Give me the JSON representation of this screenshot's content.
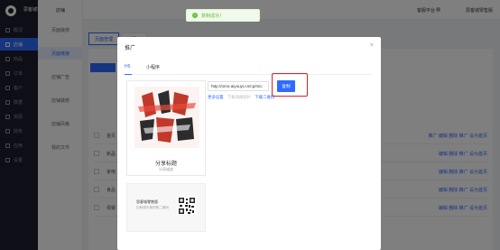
{
  "app": {
    "brand": "思客城零售版"
  },
  "topbar": {
    "help": "客服平台",
    "user": "思客城零售版"
  },
  "sidebar": {
    "items": [
      {
        "label": "概况"
      },
      {
        "label": "店铺"
      },
      {
        "label": "商品"
      },
      {
        "label": "订单"
      },
      {
        "label": "客户"
      },
      {
        "label": "数据"
      },
      {
        "label": "资源"
      },
      {
        "label": "财务"
      },
      {
        "label": "应用"
      },
      {
        "label": "设置"
      }
    ]
  },
  "subside": {
    "title": "店铺",
    "items": [
      {
        "label": "页面装修"
      },
      {
        "label": "页面链接"
      },
      {
        "label": "店铺广告"
      },
      {
        "label": "店铺装修"
      },
      {
        "label": "店铺风格"
      },
      {
        "label": "我的文件"
      }
    ]
  },
  "page": {
    "tabs": [
      {
        "label": "页面管理"
      },
      {
        "label": "微页面"
      }
    ],
    "rows": [
      {
        "name": "首页",
        "ops": "推广 编辑 删除 推广 设为首页"
      },
      {
        "name": "新品",
        "ops": "编辑 删除 推广 设为首页"
      },
      {
        "name": "家电",
        "ops": "编辑 删除 推广 设为首页"
      },
      {
        "name": "食品",
        "ops": "编辑 删除 推广 设为首页"
      },
      {
        "name": "母婴",
        "ops": "编辑 删除 推广 设为首页"
      }
    ]
  },
  "toast": {
    "text": "复制成功！"
  },
  "modal": {
    "title": "推广",
    "tabs": [
      {
        "label": "H5"
      },
      {
        "label": "小程序"
      }
    ],
    "poster": {
      "title": "分享标题",
      "subtitle": "分享描述"
    },
    "qr_card": {
      "title": "思客城零售版",
      "subtitle": "扫码或长按识别二维码"
    },
    "link_value": "http://omo.aiyouyi.cn/cp/mic",
    "copy_label": "复制",
    "links": [
      {
        "text": "更多设置",
        "style": "blue"
      },
      {
        "text": "下载海报图片",
        "style": "gray"
      },
      {
        "text": "下载二维码",
        "style": "blue"
      }
    ]
  }
}
